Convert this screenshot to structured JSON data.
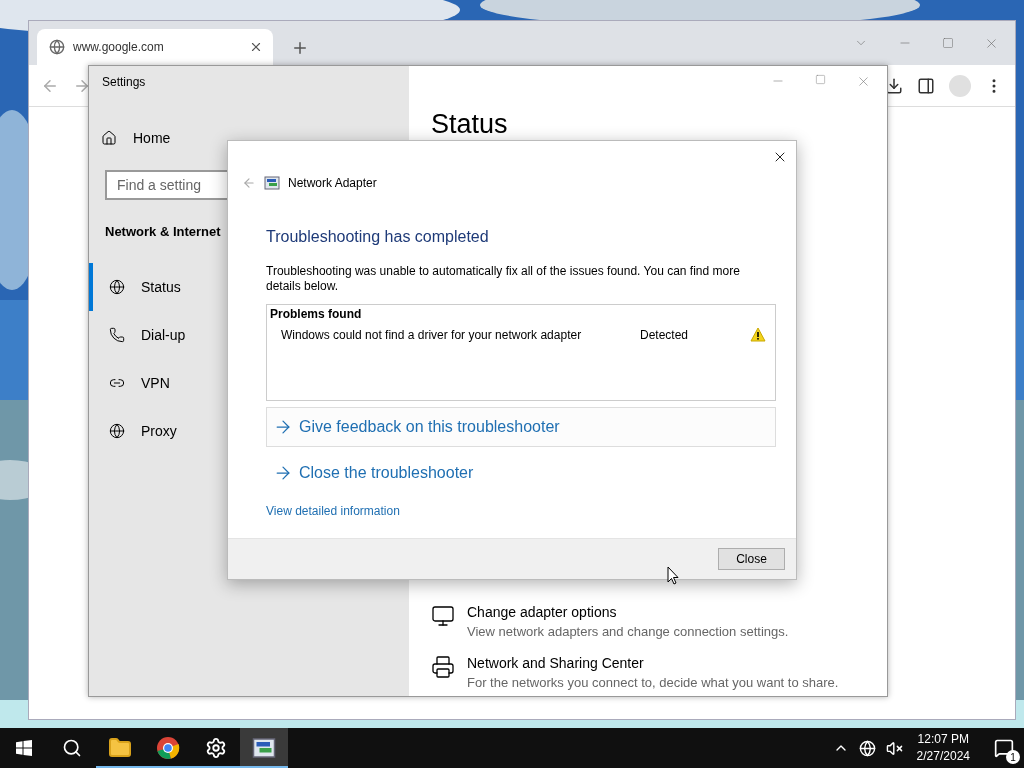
{
  "browser": {
    "tab": {
      "title": "www.google.com"
    }
  },
  "settings": {
    "title": "Settings",
    "home": "Home",
    "search": {
      "placeholder": "Find a setting"
    },
    "section": "Network & Internet",
    "nav": [
      {
        "label": "Status",
        "kind": "status",
        "selected": true
      },
      {
        "label": "Dial-up",
        "kind": "dialup",
        "selected": false
      },
      {
        "label": "VPN",
        "kind": "vpn",
        "selected": false
      },
      {
        "label": "Proxy",
        "kind": "proxy",
        "selected": false
      }
    ],
    "heading": "Status",
    "options": [
      {
        "kind": "adapter",
        "title": "Change adapter options",
        "description": "View network adapters and change connection settings."
      },
      {
        "kind": "sharing",
        "title": "Network and Sharing Center",
        "description": "For the networks you connect to, decide what you want to share."
      }
    ]
  },
  "dialog": {
    "title": "Network Adapter",
    "heading": "Troubleshooting has completed",
    "message": "Troubleshooting was unable to automatically fix all of the issues found. You can find more details below.",
    "problems": {
      "header": "Problems found",
      "rows": [
        {
          "problem": "Windows could not find a driver for your network adapter",
          "status": "Detected",
          "kind": "warning"
        }
      ]
    },
    "links": [
      {
        "label": "Give feedback on this troubleshooter",
        "focused": true
      },
      {
        "label": "Close the troubleshooter",
        "focused": false
      }
    ],
    "details_link": "View detailed information",
    "button": "Close"
  },
  "taskbar": {
    "apps": [
      {
        "kind": "files",
        "running": true,
        "selected": false
      },
      {
        "kind": "browser",
        "running": true,
        "selected": false
      },
      {
        "kind": "settings",
        "running": true,
        "selected": false
      },
      {
        "kind": "adapter",
        "running": true,
        "selected": true
      }
    ],
    "clock": {
      "time": "12:07 PM",
      "date": "2/27/2024"
    },
    "notifications": "1"
  }
}
